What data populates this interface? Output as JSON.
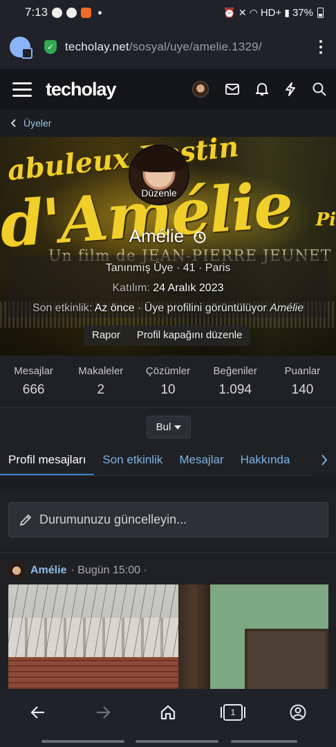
{
  "status_bar": {
    "time": "7:13",
    "network": "HD+",
    "battery": "37%"
  },
  "browser": {
    "url_host": "techolay.net",
    "url_path": "/sosyal/uye/amelie.1329/"
  },
  "site": {
    "logo": "techolay"
  },
  "breadcrumb": {
    "label": "Üyeler"
  },
  "cover": {
    "poster_line1": "abuleux Destin",
    "poster_line2": "d'Amélie",
    "poster_line3": "Pi",
    "poster_credit": "Un film de JEAN-PIERRE JEUNET",
    "avatar_edit": "Düzenle",
    "name": "Amélie",
    "title_line": "Tanınmış Üye · 41 · Paris",
    "joined_label": "Katılım:",
    "joined_value": "24 Aralık 2023",
    "activity_label": "Son etkinlik:",
    "activity_when": "Az önce",
    "activity_sep": " · ",
    "activity_text": "Üye profilini görüntülüyor",
    "activity_target": "Amélie",
    "report_button": "Rapor",
    "edit_cover_button": "Profil kapağını düzenle"
  },
  "stats": [
    {
      "label": "Mesajlar",
      "value": "666"
    },
    {
      "label": "Makaleler",
      "value": "2"
    },
    {
      "label": "Çözümler",
      "value": "10"
    },
    {
      "label": "Beğeniler",
      "value": "1.094"
    },
    {
      "label": "Puanlar",
      "value": "140"
    }
  ],
  "find_button": "Bul",
  "tabs": [
    {
      "label": "Profil mesajları",
      "active": true
    },
    {
      "label": "Son etkinlik"
    },
    {
      "label": "Mesajlar"
    },
    {
      "label": "Hakkında"
    }
  ],
  "status_update": {
    "placeholder": "Durumunuzu güncelleyin..."
  },
  "post": {
    "author": "Amélie",
    "time": "· Bugün 15:00 ·"
  },
  "colors": {
    "accent": "#3b84d0",
    "link": "#7fb2e6",
    "bg": "#1f2124"
  }
}
